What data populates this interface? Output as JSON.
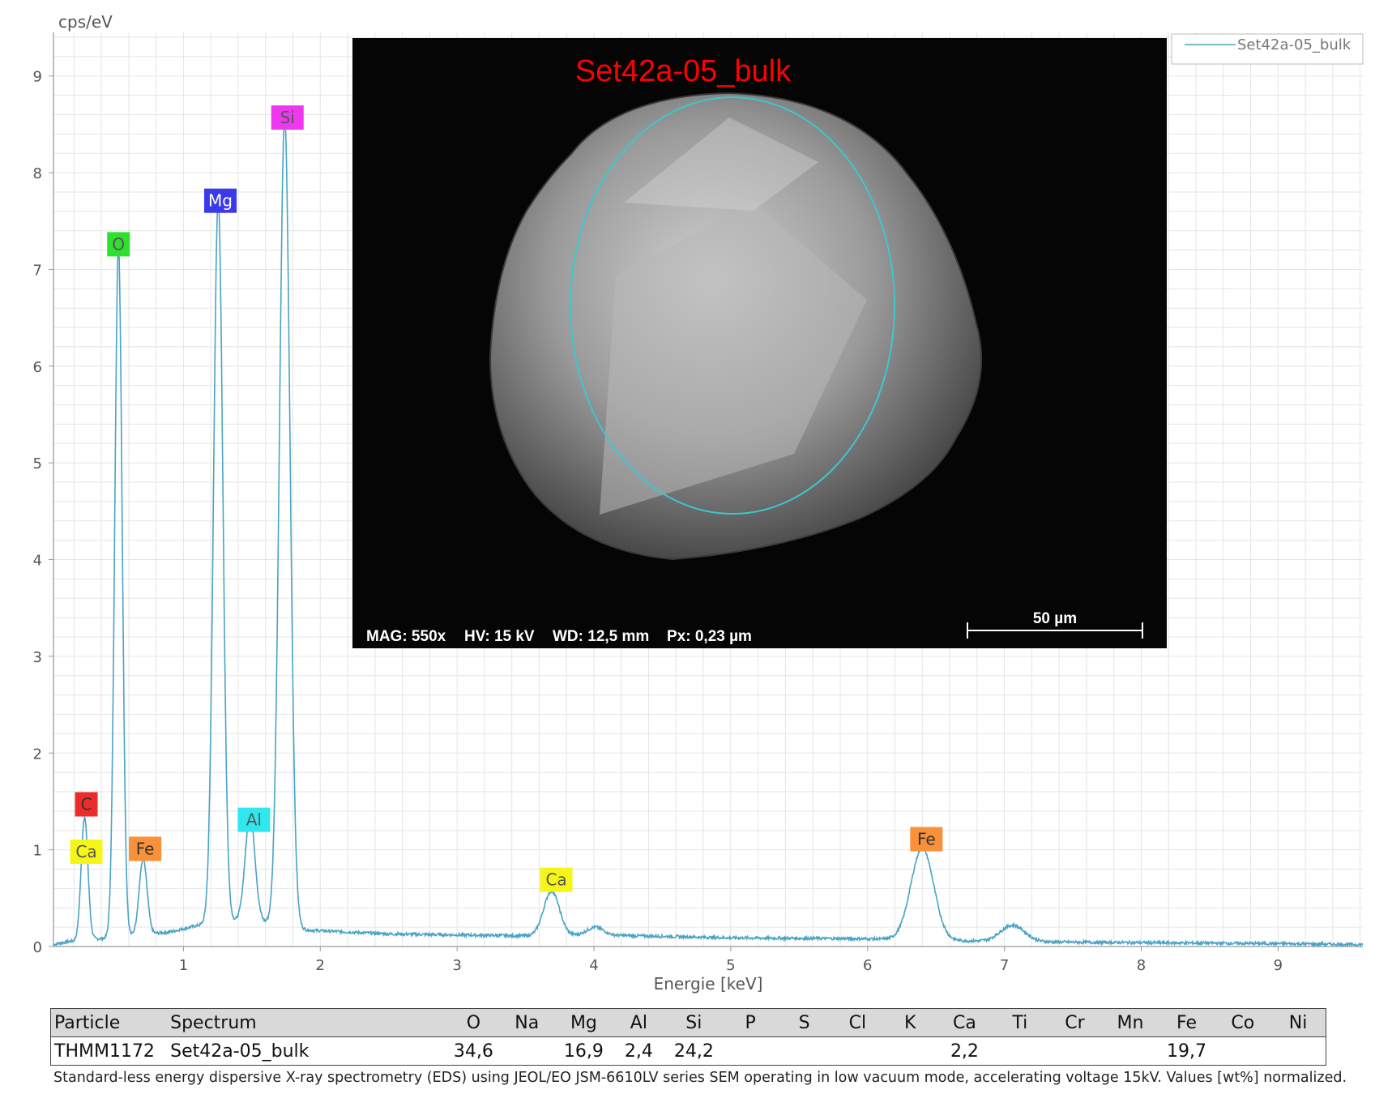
{
  "chart_data": {
    "type": "line",
    "y_unit_label": "cps/eV",
    "xlabel": "Energie [keV]",
    "xlim": [
      0.05,
      9.62
    ],
    "ylim": [
      0,
      9.45
    ],
    "x_ticks": [
      1,
      2,
      3,
      4,
      5,
      6,
      7,
      8,
      9
    ],
    "y_ticks": [
      0,
      1,
      2,
      3,
      4,
      5,
      6,
      7,
      8,
      9
    ],
    "grid": true,
    "legend_position": "top-right",
    "series": [
      {
        "name": "Set42a-05_bulk",
        "color": "#4aa3c4",
        "baseline": [
          [
            0.05,
            0.02
          ],
          [
            0.15,
            0.05
          ],
          [
            0.6,
            0.11
          ],
          [
            0.9,
            0.15
          ],
          [
            1.2,
            0.25
          ],
          [
            1.4,
            0.27
          ],
          [
            1.7,
            0.24
          ],
          [
            1.9,
            0.17
          ],
          [
            2.5,
            0.13
          ],
          [
            3.5,
            0.11
          ],
          [
            4.0,
            0.12
          ],
          [
            5.0,
            0.09
          ],
          [
            6.0,
            0.08
          ],
          [
            7.0,
            0.05
          ],
          [
            8.0,
            0.04
          ],
          [
            9.0,
            0.03
          ],
          [
            9.62,
            0.02
          ]
        ],
        "peaks": [
          {
            "element": "C",
            "energy": 0.277,
            "height": 1.27
          },
          {
            "element": "O",
            "energy": 0.525,
            "height": 7.15
          },
          {
            "element": "Fe",
            "energy": 0.705,
            "height": 0.78
          },
          {
            "element": "Mg",
            "energy": 1.254,
            "height": 7.48
          },
          {
            "element": "Al",
            "energy": 1.487,
            "height": 1.1
          },
          {
            "element": "Si",
            "energy": 1.74,
            "height": 8.35
          },
          {
            "element": "Ca",
            "energy": 3.69,
            "height": 0.46
          },
          {
            "element": "Ca",
            "energy": 4.01,
            "height": 0.08
          },
          {
            "element": "Fe",
            "energy": 6.4,
            "height": 0.95
          },
          {
            "element": "Fe",
            "energy": 7.06,
            "height": 0.17
          }
        ]
      }
    ],
    "peak_labels": [
      {
        "text": "C",
        "energy": 0.29,
        "y": 1.47,
        "bg": "#ee2b2b",
        "fg": "#333333"
      },
      {
        "text": "Ca",
        "energy": 0.29,
        "y": 0.98,
        "bg": "#f5f518",
        "fg": "#555555"
      },
      {
        "text": "O",
        "energy": 0.525,
        "y": 7.26,
        "bg": "#2fe02f",
        "fg": "#555555"
      },
      {
        "text": "Fe",
        "energy": 0.72,
        "y": 1.01,
        "bg": "#f8913a",
        "fg": "#333333"
      },
      {
        "text": "Mg",
        "energy": 1.27,
        "y": 7.71,
        "bg": "#3a3ae8",
        "fg": "#ffffff"
      },
      {
        "text": "Al",
        "energy": 1.515,
        "y": 1.31,
        "bg": "#2ee8ee",
        "fg": "#555555"
      },
      {
        "text": "Si",
        "energy": 1.76,
        "y": 8.57,
        "bg": "#f037f0",
        "fg": "#555555"
      },
      {
        "text": "Ca",
        "energy": 3.725,
        "y": 0.69,
        "bg": "#f5f518",
        "fg": "#555555"
      },
      {
        "text": "Fe",
        "energy": 6.43,
        "y": 1.11,
        "bg": "#f8913a",
        "fg": "#333333"
      }
    ]
  },
  "sem_image": {
    "title": "Set42a-05_bulk",
    "info": [
      "MAG: 550x",
      "HV: 15 kV",
      "WD: 12,5 mm",
      "Px: 0,23 µm"
    ],
    "scale_bar": "50 µm"
  },
  "table": {
    "headers": [
      "Particle",
      "Spectrum",
      "O",
      "Na",
      "Mg",
      "Al",
      "Si",
      "P",
      "S",
      "Cl",
      "K",
      "Ca",
      "Ti",
      "Cr",
      "Mn",
      "Fe",
      "Co",
      "Ni"
    ],
    "rows": [
      [
        "THMM1172",
        "Set42a-05_bulk",
        "34,6",
        "",
        "16,9",
        "2,4",
        "24,2",
        "",
        "",
        "",
        "",
        "2,2",
        "",
        "",
        "",
        "19,7",
        "",
        ""
      ]
    ]
  },
  "footnote": "Standard-less energy dispersive X-ray spectrometry (EDS) using JEOL/EO JSM-6610LV series SEM operating in low vacuum mode, accelerating voltage 15kV. Values [wt%] normalized."
}
